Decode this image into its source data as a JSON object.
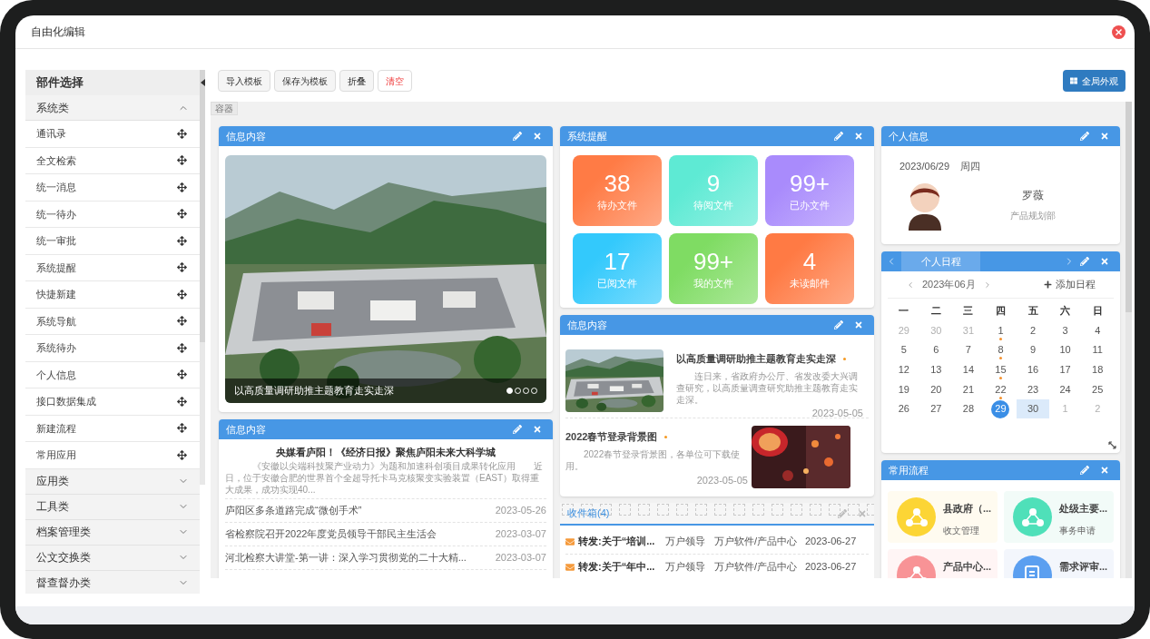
{
  "window": {
    "title": "自由化编辑"
  },
  "sidebar": {
    "title": "部件选择",
    "groups": [
      {
        "label": "系统类",
        "expanded": true,
        "items": [
          "通讯录",
          "全文检索",
          "统一消息",
          "统一待办",
          "统一审批",
          "系统提醒",
          "快捷新建",
          "系统导航",
          "系统待办",
          "个人信息",
          "接口数据集成",
          "新建流程",
          "常用应用"
        ]
      },
      {
        "label": "应用类",
        "expanded": false
      },
      {
        "label": "工具类",
        "expanded": false
      },
      {
        "label": "档案管理类",
        "expanded": false
      },
      {
        "label": "公文交换类",
        "expanded": false
      },
      {
        "label": "督查督办类",
        "expanded": false
      }
    ]
  },
  "toolbar": {
    "buttons": [
      {
        "label": "导入模板",
        "kind": "default"
      },
      {
        "label": "保存为模板",
        "kind": "default"
      },
      {
        "label": "折叠",
        "kind": "default"
      },
      {
        "label": "清空",
        "kind": "danger"
      }
    ],
    "appearance_button": "全局外观"
  },
  "container_label": "容器",
  "carousel_panel": {
    "title": "信息内容",
    "caption": "以高质量调研助推主题教育走实走深",
    "slides": [
      {
        "selected": true
      },
      {
        "selected": false
      },
      {
        "selected": false
      },
      {
        "selected": false
      }
    ]
  },
  "news_panel": {
    "title": "信息内容",
    "headline": "央媒看庐阳！《经济日报》聚焦庐阳未来大科学城",
    "summary": "《安徽以尖端科技聚产业动力》为题和加速科创项目成果转化应用　　近日，位于安徽合肥的世界首个全超导托卡马克核聚变实验装置（EAST）取得重大成果，成功实现40...",
    "rows": [
      {
        "title": "庐阳区多条道路完成“微创手术”",
        "date": "2023-05-26"
      },
      {
        "title": "省检察院召开2022年度党员领导干部民主生活会",
        "date": "2023-03-07"
      },
      {
        "title": "河北检察大讲堂-第一讲：深入学习贯彻党的二十大精...",
        "date": "2023-03-07"
      }
    ]
  },
  "reminders": {
    "title": "系统提醒",
    "tiles": [
      {
        "count": "38",
        "label": "待办文件",
        "color": "#ff7b45"
      },
      {
        "count": "9",
        "label": "待阅文件",
        "color": "#5eead4"
      },
      {
        "count": "99+",
        "label": "已办文件",
        "color": "#a98bfc"
      },
      {
        "count": "17",
        "label": "已阅文件",
        "color": "#33c9fc"
      },
      {
        "count": "99+",
        "label": "我的文件",
        "color": "#7fdc63"
      },
      {
        "count": "4",
        "label": "未读邮件",
        "color": "#ff7a44"
      }
    ]
  },
  "news_panel_2": {
    "title": "信息内容",
    "items": [
      {
        "kind": "image-left",
        "title": "以高质量调研助推主题教育走实走深",
        "summary": "连日来，省政府办公厅、省发改委大兴调查研究，以高质量调查研究助推主题教育走实走深。",
        "date": "2023-05-05"
      },
      {
        "kind": "image-right",
        "title": "2022春节登录背景图",
        "summary": "2022春节登录背景图，各单位可下载使用。",
        "date": "2023-05-05"
      }
    ]
  },
  "inbox": {
    "title": "收件箱(4)",
    "rows": [
      {
        "subject": "转发:关于“培训...",
        "sender": "万户领导",
        "department": "万户软件/产品中心",
        "date": "2023-06-27"
      },
      {
        "subject": "转发:关于“年中...",
        "sender": "万户领导",
        "department": "万户软件/产品中心",
        "date": "2023-06-27"
      }
    ]
  },
  "profile": {
    "title": "个人信息",
    "date": "2023/06/29",
    "weekday": "周四",
    "name": "罗薇",
    "department": "产品规划部"
  },
  "schedule": {
    "title": "个人日程",
    "month": "2023年06月",
    "add_button": "添加日程",
    "weekdays": [
      "一",
      "二",
      "三",
      "四",
      "五",
      "六",
      "日"
    ],
    "weeks": [
      [
        {
          "day": "29",
          "other_month": true,
          "event": false,
          "selected": false,
          "highlighted": false
        },
        {
          "day": "30",
          "other_month": true,
          "event": false,
          "selected": false,
          "highlighted": false
        },
        {
          "day": "31",
          "other_month": true,
          "event": false,
          "selected": false,
          "highlighted": false
        },
        {
          "day": "1",
          "other_month": false,
          "event": true,
          "selected": false,
          "highlighted": false
        },
        {
          "day": "2",
          "other_month": false,
          "event": false,
          "selected": false,
          "highlighted": false
        },
        {
          "day": "3",
          "other_month": false,
          "event": false,
          "selected": false,
          "highlighted": false
        },
        {
          "day": "4",
          "other_month": false,
          "event": false,
          "selected": false,
          "highlighted": false
        }
      ],
      [
        {
          "day": "5",
          "other_month": false,
          "event": false,
          "selected": false,
          "highlighted": false
        },
        {
          "day": "6",
          "other_month": false,
          "event": false,
          "selected": false,
          "highlighted": false
        },
        {
          "day": "7",
          "other_month": false,
          "event": false,
          "selected": false,
          "highlighted": false
        },
        {
          "day": "8",
          "other_month": false,
          "event": true,
          "selected": false,
          "highlighted": false
        },
        {
          "day": "9",
          "other_month": false,
          "event": false,
          "selected": false,
          "highlighted": false
        },
        {
          "day": "10",
          "other_month": false,
          "event": false,
          "selected": false,
          "highlighted": false
        },
        {
          "day": "11",
          "other_month": false,
          "event": false,
          "selected": false,
          "highlighted": false
        }
      ],
      [
        {
          "day": "12",
          "other_month": false,
          "event": false,
          "selected": false,
          "highlighted": false
        },
        {
          "day": "13",
          "other_month": false,
          "event": false,
          "selected": false,
          "highlighted": false
        },
        {
          "day": "14",
          "other_month": false,
          "event": false,
          "selected": false,
          "highlighted": false
        },
        {
          "day": "15",
          "other_month": false,
          "event": true,
          "selected": false,
          "highlighted": false
        },
        {
          "day": "16",
          "other_month": false,
          "event": false,
          "selected": false,
          "highlighted": false
        },
        {
          "day": "17",
          "other_month": false,
          "event": false,
          "selected": false,
          "highlighted": false
        },
        {
          "day": "18",
          "other_month": false,
          "event": false,
          "selected": false,
          "highlighted": false
        }
      ],
      [
        {
          "day": "19",
          "other_month": false,
          "event": false,
          "selected": false,
          "highlighted": false
        },
        {
          "day": "20",
          "other_month": false,
          "event": false,
          "selected": false,
          "highlighted": false
        },
        {
          "day": "21",
          "other_month": false,
          "event": false,
          "selected": false,
          "highlighted": false
        },
        {
          "day": "22",
          "other_month": false,
          "event": true,
          "selected": false,
          "highlighted": false
        },
        {
          "day": "23",
          "other_month": false,
          "event": false,
          "selected": false,
          "highlighted": false
        },
        {
          "day": "24",
          "other_month": false,
          "event": false,
          "selected": false,
          "highlighted": false
        },
        {
          "day": "25",
          "other_month": false,
          "event": false,
          "selected": false,
          "highlighted": false
        }
      ],
      [
        {
          "day": "26",
          "other_month": false,
          "event": false,
          "selected": false,
          "highlighted": false
        },
        {
          "day": "27",
          "other_month": false,
          "event": false,
          "selected": false,
          "highlighted": false
        },
        {
          "day": "28",
          "other_month": false,
          "event": false,
          "selected": false,
          "highlighted": false
        },
        {
          "day": "29",
          "other_month": false,
          "event": false,
          "selected": true,
          "highlighted": false
        },
        {
          "day": "30",
          "other_month": false,
          "event": false,
          "selected": false,
          "highlighted": true
        },
        {
          "day": "1",
          "other_month": true,
          "event": false,
          "selected": false,
          "highlighted": false
        },
        {
          "day": "2",
          "other_month": true,
          "event": false,
          "selected": false,
          "highlighted": false
        }
      ]
    ]
  },
  "workflows": {
    "title": "常用流程",
    "items": [
      {
        "kind": "network",
        "title": "县政府（...",
        "subtitle": "收文管理",
        "color": "#fcd535"
      },
      {
        "kind": "network",
        "title": "处级主要...",
        "subtitle": "事务申请",
        "color": "#4fe0b9"
      },
      {
        "kind": "network",
        "title": "产品中心...",
        "color": "#f89396"
      },
      {
        "kind": "document",
        "title": "需求评审...",
        "color": "#5b9ff0"
      }
    ]
  }
}
